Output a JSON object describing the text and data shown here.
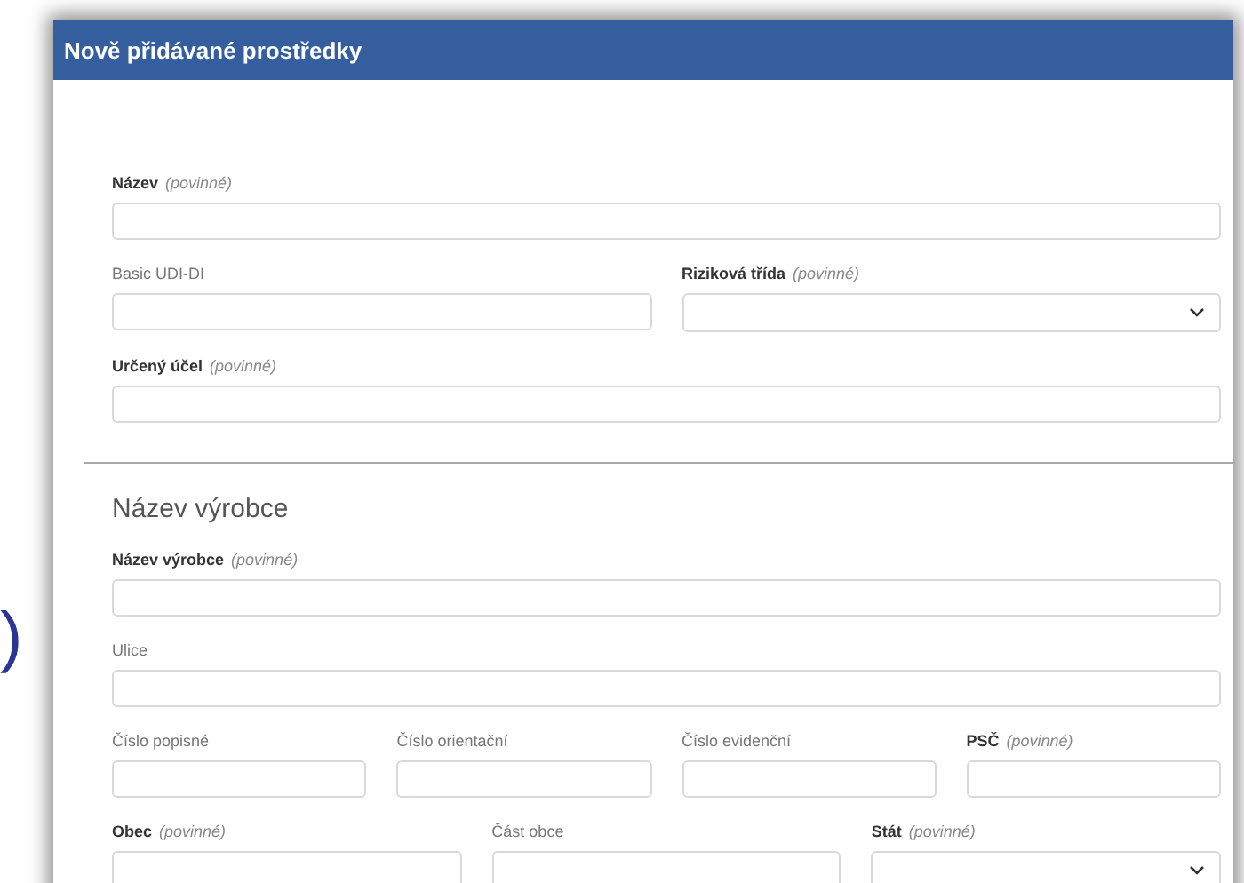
{
  "stray_text": ")",
  "window": {
    "title": "Nově přidávané prostředky"
  },
  "sections": [
    {
      "rows": [
        [
          {
            "label": "Název",
            "hint": "(povinné)",
            "required": true,
            "kind": "text"
          }
        ],
        [
          {
            "label": "Basic UDI-DI",
            "required": false,
            "kind": "text"
          },
          {
            "label": "Riziková třída",
            "hint": "(povinné)",
            "required": true,
            "kind": "select"
          }
        ],
        [
          {
            "label": "Určený účel",
            "hint": "(povinné)",
            "required": true,
            "kind": "text"
          }
        ]
      ]
    },
    {
      "heading": "Název výrobce",
      "rows": [
        [
          {
            "label": "Název výrobce",
            "hint": "(povinné)",
            "required": true,
            "kind": "text"
          }
        ],
        [
          {
            "label": "Ulice",
            "required": false,
            "kind": "text"
          }
        ],
        [
          {
            "label": "Číslo popisné",
            "required": false,
            "kind": "text"
          },
          {
            "label": "Číslo orientační",
            "required": false,
            "kind": "text"
          },
          {
            "label": "Číslo evidenční",
            "required": false,
            "kind": "text"
          },
          {
            "label": "PSČ",
            "hint": "(povinné)",
            "required": true,
            "kind": "text"
          }
        ],
        [
          {
            "label": "Obec",
            "hint": "(povinné)",
            "required": true,
            "kind": "text"
          },
          {
            "label": "Část obce",
            "required": false,
            "kind": "text"
          },
          {
            "label": "Stát",
            "hint": "(povinné)",
            "required": true,
            "kind": "select"
          }
        ]
      ]
    }
  ]
}
